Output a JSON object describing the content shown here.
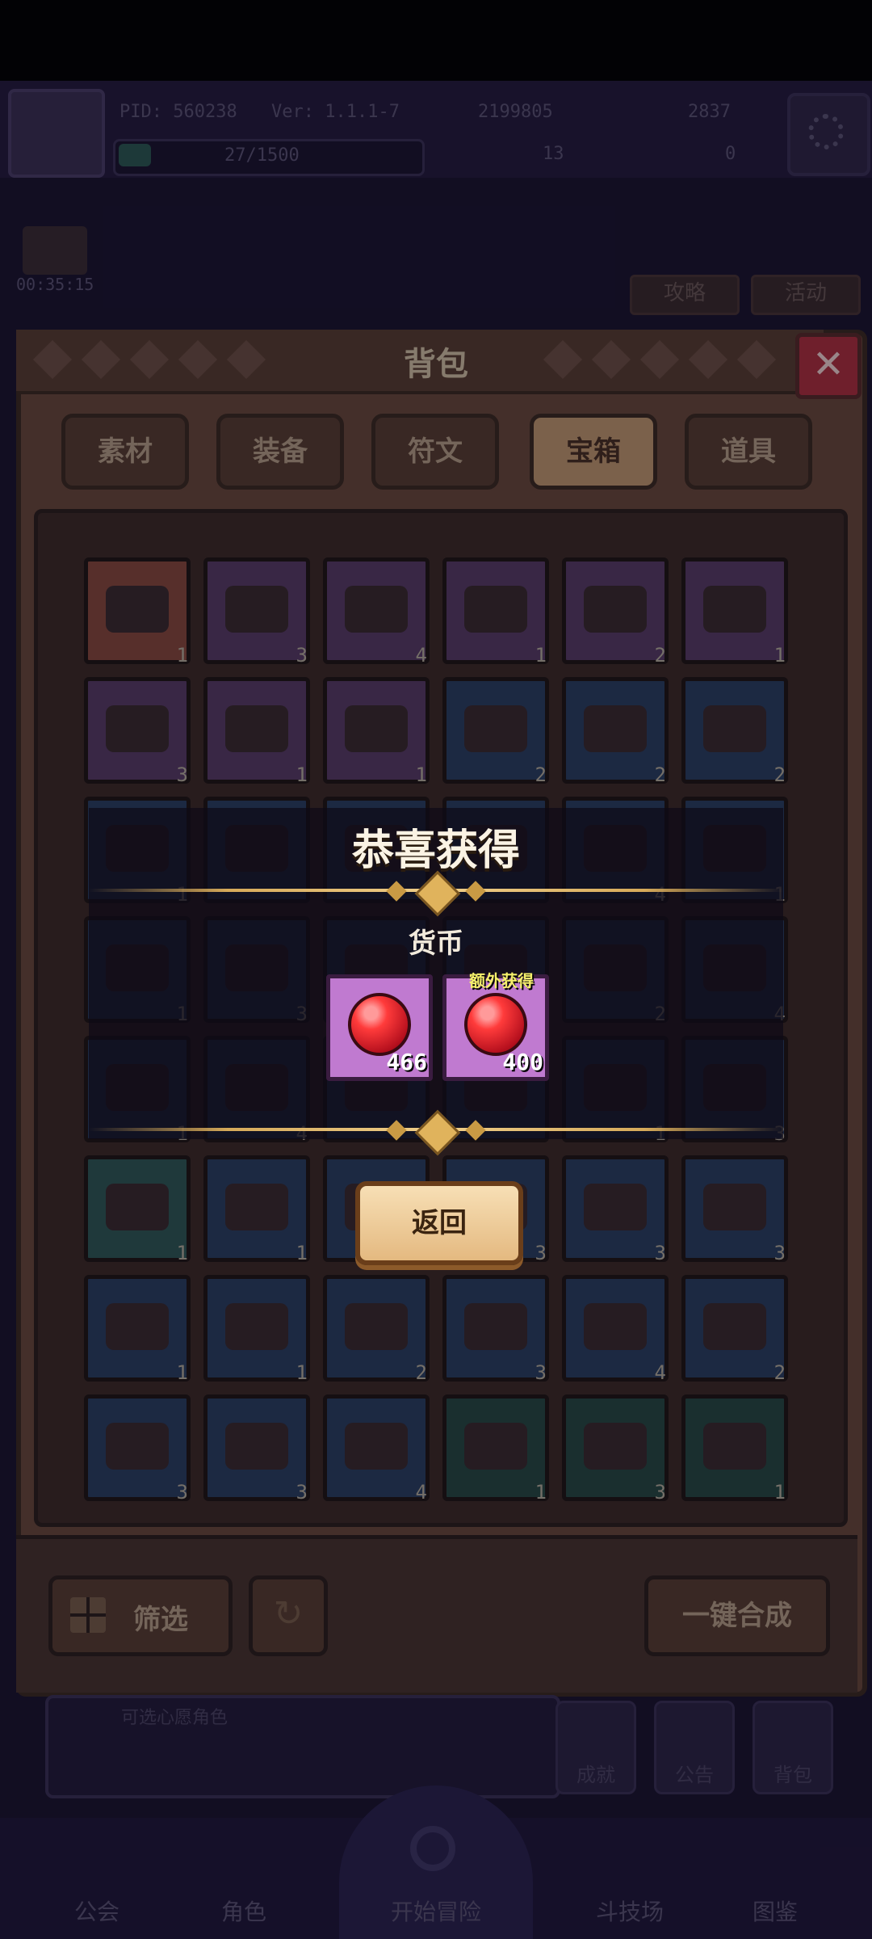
{
  "top_bar": {
    "pid": "PID: 560238",
    "version": "Ver: 1.1.1-7",
    "gold": "2199805",
    "gems": "2837",
    "energy": "27/1500",
    "clover": "13",
    "potion": "0"
  },
  "timer": "00:35:15",
  "side_buttons": {
    "guide": "攻略",
    "event": "活动"
  },
  "panel": {
    "title": "背包",
    "close_icon": "close-icon",
    "tabs": [
      {
        "label": "素材",
        "active": false
      },
      {
        "label": "装备",
        "active": false
      },
      {
        "label": "符文",
        "active": false
      },
      {
        "label": "宝箱",
        "active": true
      },
      {
        "label": "道具",
        "active": false
      }
    ],
    "filter_label": "筛选",
    "merge_label": "一键合成"
  },
  "grid": {
    "rows": [
      [
        {
          "count": "1",
          "color": "orange"
        },
        {
          "count": "3",
          "color": "purple"
        },
        {
          "count": "4",
          "color": "purple"
        },
        {
          "count": "1",
          "color": "purple"
        },
        {
          "count": "2",
          "color": "purple"
        },
        {
          "count": "1",
          "color": "purple"
        }
      ],
      [
        {
          "count": "3",
          "color": "purple"
        },
        {
          "count": "1",
          "color": "purple"
        },
        {
          "count": "1",
          "color": "purple"
        },
        {
          "count": "2",
          "color": "blue"
        },
        {
          "count": "2",
          "color": "blue"
        },
        {
          "count": "2",
          "color": "blue"
        }
      ],
      [
        {
          "count": "1",
          "color": "blue"
        },
        {
          "count": "",
          "color": "blue"
        },
        {
          "count": "",
          "color": "blue"
        },
        {
          "count": "",
          "color": "blue"
        },
        {
          "count": "4",
          "color": "blue"
        },
        {
          "count": "1",
          "color": "blue"
        }
      ],
      [
        {
          "count": "1",
          "color": "blue"
        },
        {
          "count": "3",
          "color": "blue"
        },
        {
          "count": "",
          "color": "blue"
        },
        {
          "count": "",
          "color": "blue"
        },
        {
          "count": "2",
          "color": "blue"
        },
        {
          "count": "4",
          "color": "blue"
        }
      ],
      [
        {
          "count": "1",
          "color": "blue"
        },
        {
          "count": "4",
          "color": "blue"
        },
        {
          "count": "",
          "color": "blue"
        },
        {
          "count": "",
          "color": "blue"
        },
        {
          "count": "1",
          "color": "blue"
        },
        {
          "count": "3",
          "color": "blue"
        }
      ],
      [
        {
          "count": "1",
          "color": "teal"
        },
        {
          "count": "1",
          "color": "blue"
        },
        {
          "count": "",
          "color": "blue"
        },
        {
          "count": "3",
          "color": "blue"
        },
        {
          "count": "3",
          "color": "blue"
        },
        {
          "count": "3",
          "color": "blue"
        }
      ],
      [
        {
          "count": "1",
          "color": "blue"
        },
        {
          "count": "1",
          "color": "blue"
        },
        {
          "count": "2",
          "color": "blue"
        },
        {
          "count": "3",
          "color": "blue"
        },
        {
          "count": "4",
          "color": "blue"
        },
        {
          "count": "2",
          "color": "blue"
        }
      ],
      [
        {
          "count": "3",
          "color": "blue"
        },
        {
          "count": "3",
          "color": "blue"
        },
        {
          "count": "4",
          "color": "blue"
        },
        {
          "count": "1",
          "color": "green"
        },
        {
          "count": "3",
          "color": "green"
        },
        {
          "count": "1",
          "color": "green"
        }
      ]
    ]
  },
  "lower_hud": {
    "hint": "可选心愿角色",
    "achievement": "成就",
    "notice": "公告",
    "bag": "背包"
  },
  "bottom_nav": [
    {
      "label": "公会"
    },
    {
      "label": "角色"
    },
    {
      "label": "开始冒险"
    },
    {
      "label": "斗技场"
    },
    {
      "label": "图鉴"
    }
  ],
  "reward_popup": {
    "title": "恭喜获得",
    "category": "货币",
    "bonus_tag": "额外获得",
    "items": [
      {
        "icon": "red-gem-icon",
        "amount": "466"
      },
      {
        "icon": "red-gem-icon",
        "amount": "400"
      }
    ],
    "return_label": "返回"
  },
  "colors": {
    "panel_brown": "#6b4a3c",
    "active_tab": "#c49a72",
    "reward_slot": "#c07ad0",
    "gem_red": "#ff3b3b",
    "gold_line": "#d6aa5a",
    "bonus_yellow": "#f5f06a"
  }
}
